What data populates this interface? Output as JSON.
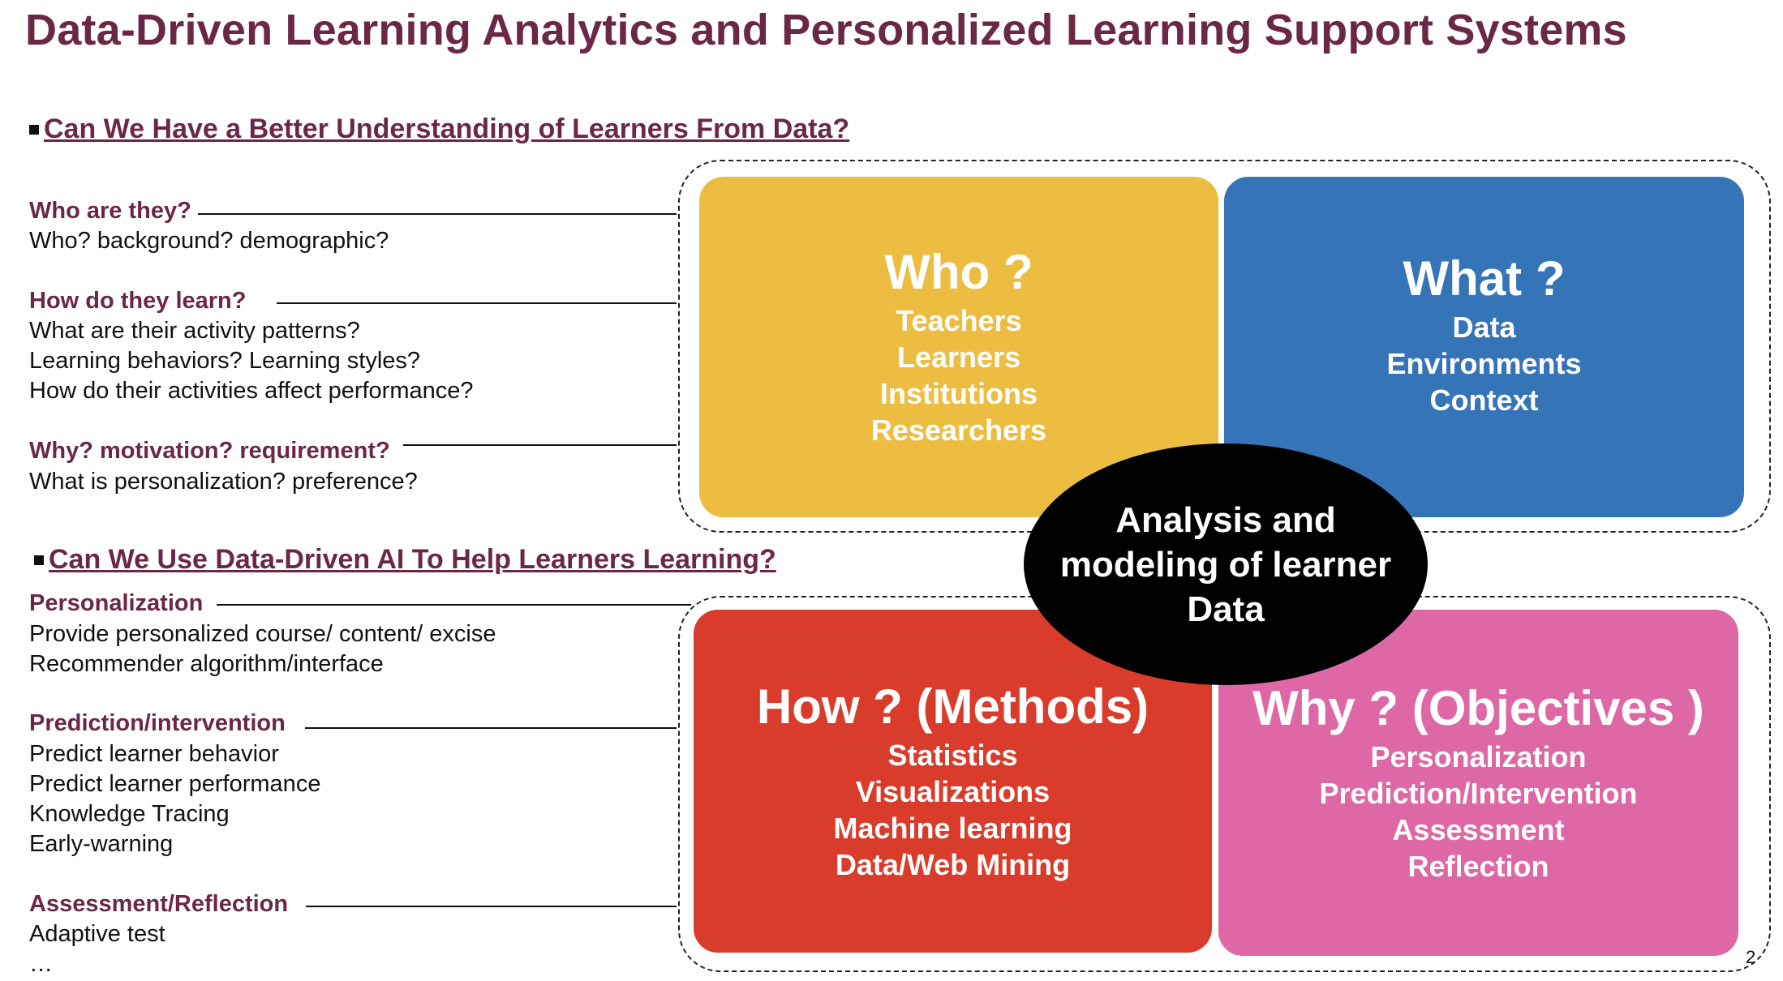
{
  "title": "Data-Driven Learning Analytics and Personalized Learning Support Systems",
  "section1": {
    "heading": "Can We Have a Better Understanding of Learners From Data?",
    "groups": [
      {
        "question": "Who are they?",
        "lines": [
          "Who? background? demographic?"
        ]
      },
      {
        "question": "How do they learn?",
        "lines": [
          "What are their activity patterns?",
          "Learning behaviors? Learning styles?",
          "How do their activities affect performance?"
        ]
      },
      {
        "question": "Why? motivation? requirement?",
        "lines": [
          "What is personalization? preference?"
        ]
      }
    ]
  },
  "section2": {
    "heading": "Can We Use Data-Driven AI To Help Learners Learning?",
    "groups": [
      {
        "question": "Personalization",
        "lines": [
          "Provide personalized course/ content/ excise",
          "Recommender algorithm/interface"
        ]
      },
      {
        "question": "Prediction/intervention",
        "lines": [
          "Predict learner behavior",
          "Predict learner performance",
          "Knowledge Tracing",
          "Early-warning"
        ]
      },
      {
        "question": "Assessment/Reflection",
        "lines": [
          "Adaptive test",
          "…"
        ]
      }
    ]
  },
  "cards": {
    "who": {
      "head": "Who ?",
      "items": [
        "Teachers",
        "Learners",
        "Institutions",
        "Researchers"
      ],
      "color": "#ecbd41"
    },
    "what": {
      "head": "What ?",
      "items": [
        "Data",
        "Environments",
        "Context"
      ],
      "color": "#3574b6"
    },
    "how": {
      "head": "How ? (Methods)",
      "items": [
        "Statistics",
        "Visualizations",
        "Machine learning",
        "Data/Web Mining"
      ],
      "color": "#d93c2b"
    },
    "why": {
      "head": "Why ? (Objectives )",
      "items": [
        "Personalization",
        "Prediction/Intervention",
        "Assessment",
        "Reflection"
      ],
      "color": "#de67a6"
    }
  },
  "center": {
    "lines": [
      "Analysis and",
      "modeling of learner",
      "Data"
    ]
  },
  "page_number": "2"
}
